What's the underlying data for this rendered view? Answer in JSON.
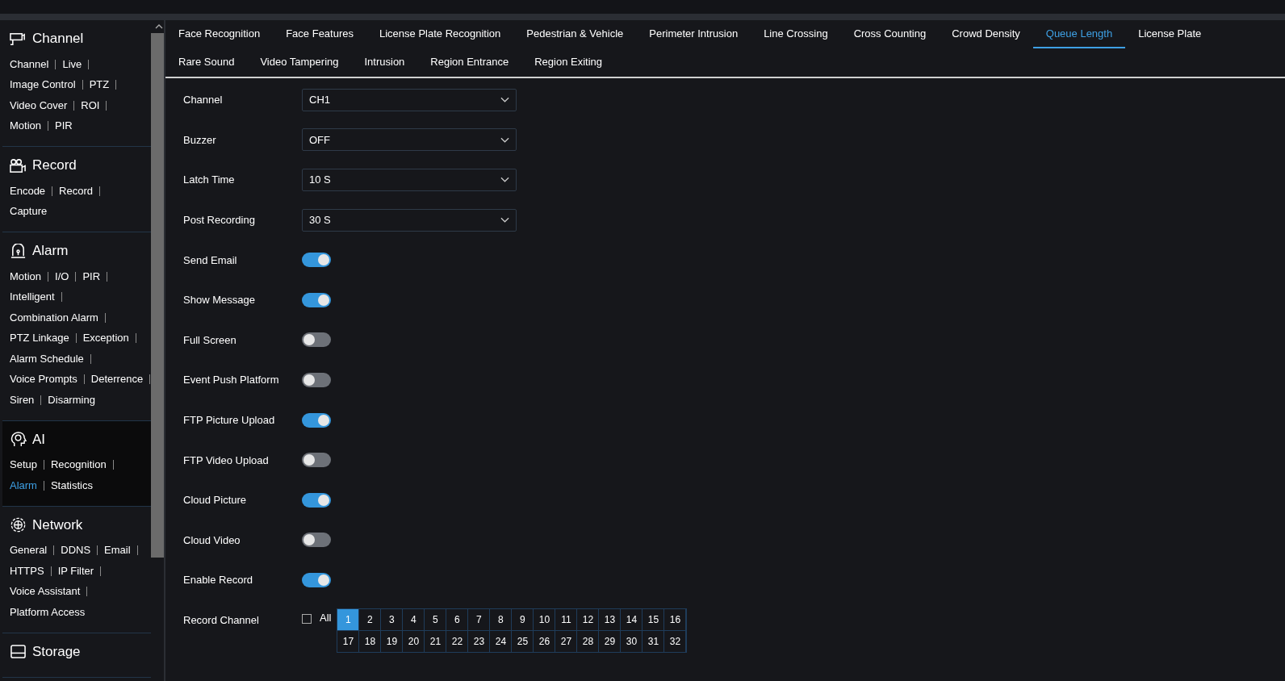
{
  "sidebar": {
    "sections": [
      {
        "title": "Channel",
        "active": false,
        "lines": [
          [
            {
              "label": "Channel",
              "selected": false
            },
            {
              "label": "Live",
              "selected": false
            }
          ],
          [
            {
              "label": "Image Control",
              "selected": false
            },
            {
              "label": "PTZ",
              "selected": false
            }
          ],
          [
            {
              "label": "Video Cover",
              "selected": false
            },
            {
              "label": "ROI",
              "selected": false
            }
          ],
          [
            {
              "label": "Motion",
              "selected": false
            },
            {
              "label": "PIR",
              "selected": false
            }
          ]
        ]
      },
      {
        "title": "Record",
        "active": false,
        "lines": [
          [
            {
              "label": "Encode",
              "selected": false
            },
            {
              "label": "Record",
              "selected": false
            }
          ],
          [
            {
              "label": "Capture",
              "selected": false
            }
          ]
        ]
      },
      {
        "title": "Alarm",
        "active": false,
        "lines": [
          [
            {
              "label": "Motion",
              "selected": false
            },
            {
              "label": "I/O",
              "selected": false
            },
            {
              "label": "PIR",
              "selected": false
            }
          ],
          [
            {
              "label": "Intelligent",
              "selected": false
            }
          ],
          [
            {
              "label": "Combination Alarm",
              "selected": false
            }
          ],
          [
            {
              "label": "PTZ Linkage",
              "selected": false
            },
            {
              "label": "Exception",
              "selected": false
            }
          ],
          [
            {
              "label": "Alarm Schedule",
              "selected": false
            }
          ],
          [
            {
              "label": "Voice Prompts",
              "selected": false
            },
            {
              "label": "Deterrence",
              "selected": false
            }
          ],
          [
            {
              "label": "Siren",
              "selected": false
            },
            {
              "label": "Disarming",
              "selected": false
            }
          ]
        ]
      },
      {
        "title": "AI",
        "active": true,
        "lines": [
          [
            {
              "label": "Setup",
              "selected": false
            },
            {
              "label": "Recognition",
              "selected": false
            }
          ],
          [
            {
              "label": "Alarm",
              "selected": true
            },
            {
              "label": "Statistics",
              "selected": false
            }
          ]
        ]
      },
      {
        "title": "Network",
        "active": false,
        "lines": [
          [
            {
              "label": "General",
              "selected": false
            },
            {
              "label": "DDNS",
              "selected": false
            },
            {
              "label": "Email",
              "selected": false
            }
          ],
          [
            {
              "label": "HTTPS",
              "selected": false
            },
            {
              "label": "IP Filter",
              "selected": false
            }
          ],
          [
            {
              "label": "Voice Assistant",
              "selected": false
            }
          ],
          [
            {
              "label": "Platform Access",
              "selected": false
            }
          ]
        ]
      },
      {
        "title": "Storage",
        "active": false
      }
    ]
  },
  "tabs": [
    {
      "label": "Face Recognition",
      "selected": false
    },
    {
      "label": "Face Features",
      "selected": false
    },
    {
      "label": "License Plate Recognition",
      "selected": false
    },
    {
      "label": "Pedestrian & Vehicle",
      "selected": false
    },
    {
      "label": "Perimeter Intrusion",
      "selected": false
    },
    {
      "label": "Line Crossing",
      "selected": false
    },
    {
      "label": "Cross Counting",
      "selected": false
    },
    {
      "label": "Crowd Density",
      "selected": false
    },
    {
      "label": "Queue Length",
      "selected": true
    },
    {
      "label": "License Plate",
      "selected": false
    },
    {
      "label": "Rare Sound",
      "selected": false
    },
    {
      "label": "Video Tampering",
      "selected": false
    },
    {
      "label": "Intrusion",
      "selected": false
    },
    {
      "label": "Region Entrance",
      "selected": false
    },
    {
      "label": "Region Exiting",
      "selected": false
    }
  ],
  "form": [
    {
      "kind": "select",
      "label": "Channel",
      "value": "CH1"
    },
    {
      "kind": "select",
      "label": "Buzzer",
      "value": "OFF"
    },
    {
      "kind": "select",
      "label": "Latch Time",
      "value": "10 S"
    },
    {
      "kind": "select",
      "label": "Post Recording",
      "value": "30 S"
    },
    {
      "kind": "toggle",
      "label": "Send Email",
      "on": true
    },
    {
      "kind": "toggle",
      "label": "Show Message",
      "on": true
    },
    {
      "kind": "toggle",
      "label": "Full Screen",
      "on": false
    },
    {
      "kind": "toggle",
      "label": "Event Push Platform",
      "on": false
    },
    {
      "kind": "toggle",
      "label": "FTP Picture Upload",
      "on": true
    },
    {
      "kind": "toggle",
      "label": "FTP Video Upload",
      "on": false
    },
    {
      "kind": "toggle",
      "label": "Cloud Picture",
      "on": true
    },
    {
      "kind": "toggle",
      "label": "Cloud Video",
      "on": false
    },
    {
      "kind": "toggle",
      "label": "Enable Record",
      "on": true
    },
    {
      "kind": "channels",
      "label": "Record Channel",
      "all_label": "All",
      "all_checked": false,
      "channels": [
        {
          "label": "1",
          "selected": true
        },
        {
          "label": "2",
          "selected": false
        },
        {
          "label": "3",
          "selected": false
        },
        {
          "label": "4",
          "selected": false
        },
        {
          "label": "5",
          "selected": false
        },
        {
          "label": "6",
          "selected": false
        },
        {
          "label": "7",
          "selected": false
        },
        {
          "label": "8",
          "selected": false
        },
        {
          "label": "9",
          "selected": false
        },
        {
          "label": "10",
          "selected": false
        },
        {
          "label": "11",
          "selected": false
        },
        {
          "label": "12",
          "selected": false
        },
        {
          "label": "13",
          "selected": false
        },
        {
          "label": "14",
          "selected": false
        },
        {
          "label": "15",
          "selected": false
        },
        {
          "label": "16",
          "selected": false
        },
        {
          "label": "17",
          "selected": false
        },
        {
          "label": "18",
          "selected": false
        },
        {
          "label": "19",
          "selected": false
        },
        {
          "label": "20",
          "selected": false
        },
        {
          "label": "21",
          "selected": false
        },
        {
          "label": "22",
          "selected": false
        },
        {
          "label": "23",
          "selected": false
        },
        {
          "label": "24",
          "selected": false
        },
        {
          "label": "25",
          "selected": false
        },
        {
          "label": "26",
          "selected": false
        },
        {
          "label": "27",
          "selected": false
        },
        {
          "label": "28",
          "selected": false
        },
        {
          "label": "29",
          "selected": false
        },
        {
          "label": "30",
          "selected": false
        },
        {
          "label": "31",
          "selected": false
        },
        {
          "label": "32",
          "selected": false
        }
      ]
    }
  ]
}
